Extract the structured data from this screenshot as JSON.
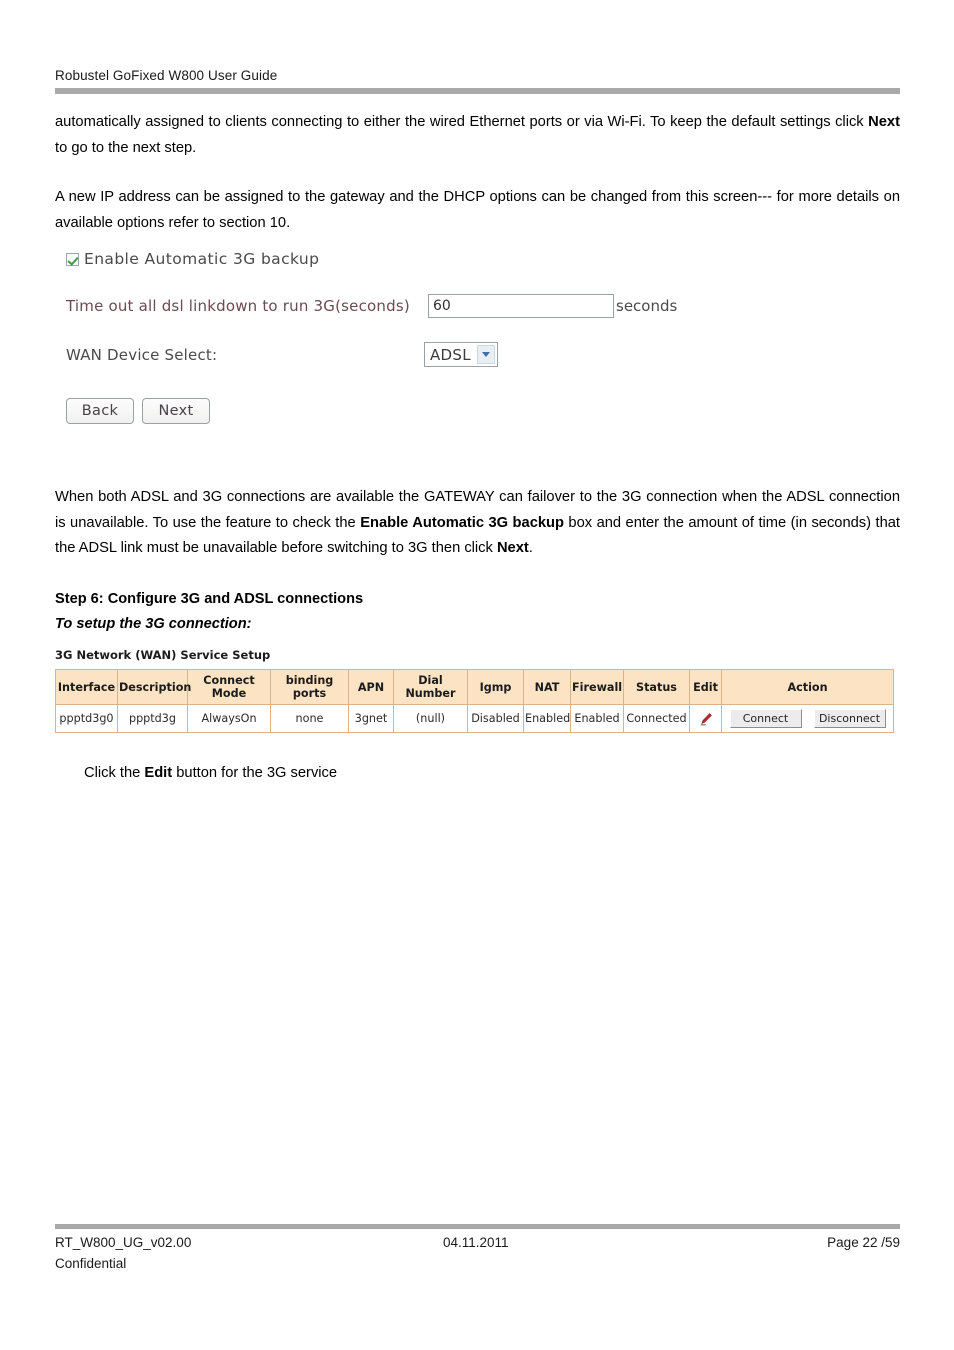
{
  "header": {
    "title": "Robustel GoFixed W800 User Guide"
  },
  "paragraphs": {
    "p1_a": "automatically assigned to clients connecting to either the wired Ethernet ports or via Wi-Fi. To keep the default settings click ",
    "p1_bold": "Next",
    "p1_b": " to go to the next step.",
    "p2": "A new IP address can be assigned to the gateway and the DHCP options can be changed from this screen--- for more details on available options refer to section 10.",
    "p3_a": "When both ADSL and 3G connections are available the GATEWAY can failover to the 3G connection when the ADSL connection is unavailable. To use the feature to check the ",
    "p3_bold1": "Enable Automatic 3G backup",
    "p3_b": " box and enter the amount of time (in seconds) that the ADSL link must be unavailable before switching to 3G then click ",
    "p3_bold2": "Next",
    "p3_c": "."
  },
  "headings": {
    "step6": "Step 6: Configure 3G and ADSL connections",
    "subtitle": "To setup the 3G connection:"
  },
  "caption": {
    "click_edit_a": "Click the ",
    "click_edit_bold": "Edit",
    "click_edit_b": " button for the 3G service"
  },
  "form": {
    "checkbox_label": "Enable Automatic 3G backup",
    "checkbox_checked": true,
    "timeout_label": "Time out all dsl linkdown to run 3G(seconds)",
    "timeout_value": "60",
    "timeout_placeholder": "",
    "timeout_unit": "seconds",
    "wan_label": "WAN Device Select:",
    "wan_value": "ADSL",
    "wan_options": [
      "ADSL"
    ],
    "back_button": "Back",
    "next_button": "Next"
  },
  "table": {
    "title": "3G Network (WAN) Service Setup",
    "columns": [
      "Interface",
      "Description",
      "Connect Mode",
      "binding ports",
      "APN",
      "Dial Number",
      "Igmp",
      "NAT",
      "Firewall",
      "Status",
      "Edit",
      "Action"
    ],
    "rows": [
      {
        "interface": "ppptd3g0",
        "description": "ppptd3g",
        "connect_mode": "AlwaysOn",
        "binding_ports": "none",
        "apn": "3gnet",
        "dial_number": "(null)",
        "igmp": "Disabled",
        "nat": "Enabled",
        "firewall": "Enabled",
        "status": "Connected",
        "edit_icon": "pencil-edit-icon",
        "action_connect": "Connect",
        "action_disconnect": "Disconnect"
      }
    ]
  },
  "footer": {
    "doc_id": "RT_W800_UG_v02.00",
    "date": "04.11.2011",
    "page": "Page 22 /59",
    "confidential": "Confidential"
  },
  "colors": {
    "rule": "#a9a9a9",
    "table_header_bg": "#fbe3c4",
    "table_border": "#d9b48a",
    "checkbox_check": "#3aa13a",
    "select_arrow": "#3f6fa5",
    "pencil": "#c0272d"
  }
}
